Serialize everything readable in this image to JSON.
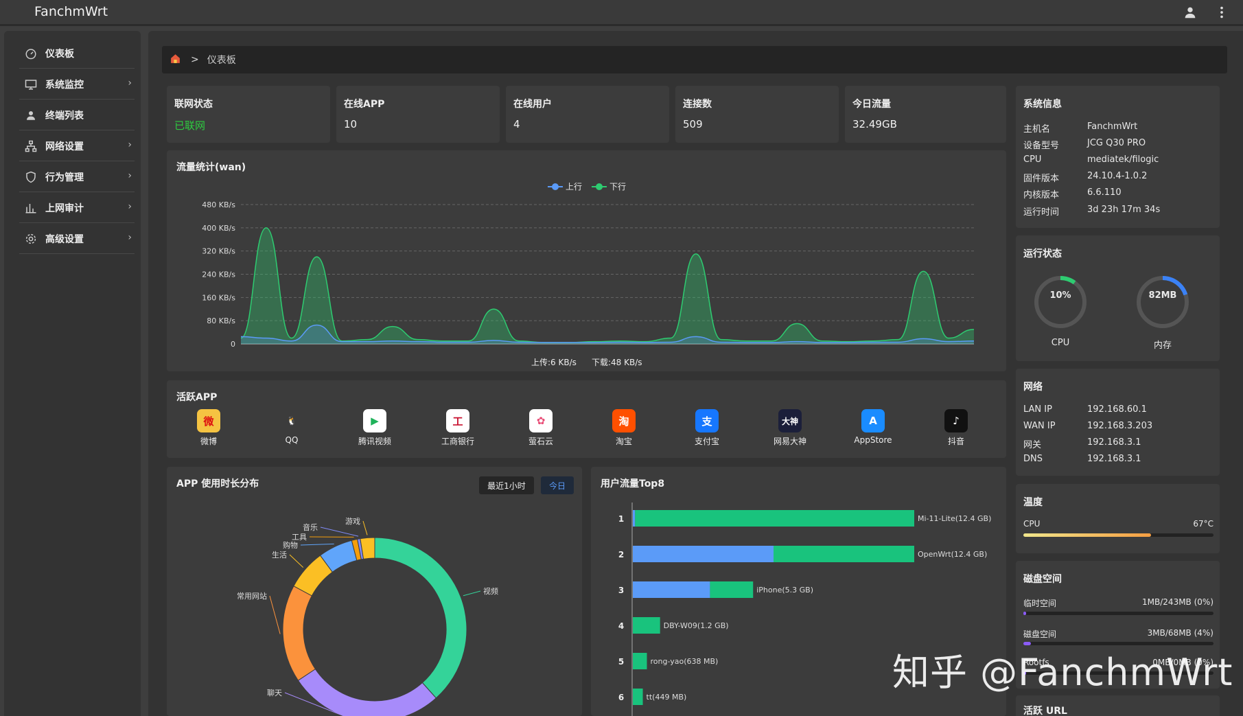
{
  "app": {
    "title": "FanchmWrt"
  },
  "topbar": {
    "user_icon": "user-icon",
    "menu_icon": "more-vertical-icon"
  },
  "sidebar": {
    "items": [
      {
        "label": "仪表板",
        "icon": "dashboard-icon",
        "has_submenu": false
      },
      {
        "label": "系统监控",
        "icon": "monitor-icon",
        "has_submenu": true
      },
      {
        "label": "终端列表",
        "icon": "user-icon",
        "has_submenu": false
      },
      {
        "label": "网络设置",
        "icon": "network-icon",
        "has_submenu": true
      },
      {
        "label": "行为管理",
        "icon": "shield-icon",
        "has_submenu": true
      },
      {
        "label": "上网审计",
        "icon": "bar-chart-icon",
        "has_submenu": true
      },
      {
        "label": "高级设置",
        "icon": "gear-icon",
        "has_submenu": true
      }
    ],
    "chevron": "›"
  },
  "breadcrumb": {
    "home_icon": "home-icon",
    "separator": ">",
    "current": "仪表板"
  },
  "stats": [
    {
      "label": "联网状态",
      "value": "已联网",
      "color": "#2ecc40"
    },
    {
      "label": "在线APP",
      "value": "10"
    },
    {
      "label": "在线用户",
      "value": "4"
    },
    {
      "label": "连接数",
      "value": "509"
    },
    {
      "label": "今日流量",
      "value": "32.49GB"
    }
  ],
  "traffic": {
    "title": "流量统计(wan)",
    "legend": [
      {
        "name": "上行",
        "color": "#5b9bf8"
      },
      {
        "name": "下行",
        "color": "#2ecc71"
      }
    ],
    "summary_up": "上传:6 KB/s",
    "summary_down": "下载:48 KB/s"
  },
  "chart_data": [
    {
      "type": "area",
      "title": "流量统计(wan)",
      "y_ticks": [
        "480 KB/s",
        "400 KB/s",
        "320 KB/s",
        "240 KB/s",
        "160 KB/s",
        "80 KB/s",
        "0"
      ],
      "ylim": [
        0,
        480
      ],
      "y_unit": "KB/s",
      "grid": true,
      "legend_position": "top-center",
      "x": [
        0,
        1,
        2,
        3,
        4,
        5,
        6,
        7,
        8,
        9,
        10,
        11,
        12,
        13,
        14,
        15,
        16,
        17,
        18,
        19,
        20,
        21,
        22,
        23,
        24,
        25,
        26,
        27,
        28,
        29
      ],
      "series": [
        {
          "name": "下行",
          "color": "#2ecc71",
          "values": [
            20,
            400,
            20,
            300,
            10,
            15,
            60,
            15,
            10,
            10,
            120,
            10,
            5,
            5,
            8,
            10,
            8,
            20,
            310,
            15,
            10,
            10,
            70,
            10,
            8,
            10,
            15,
            250,
            20,
            50
          ]
        },
        {
          "name": "上行",
          "color": "#5b9bf8",
          "values": [
            25,
            20,
            10,
            65,
            8,
            8,
            10,
            8,
            6,
            6,
            12,
            6,
            5,
            5,
            5,
            6,
            5,
            6,
            25,
            6,
            5,
            5,
            8,
            5,
            5,
            6,
            6,
            18,
            8,
            10
          ]
        }
      ]
    },
    {
      "type": "pie",
      "title": "APP 使用时长分布",
      "labels": [
        "视频",
        "聊天",
        "常用网站",
        "生活",
        "购物",
        "工具",
        "音乐",
        "游戏"
      ],
      "values": [
        38,
        27,
        17,
        7,
        6,
        1,
        0.5,
        2.5
      ],
      "colors": [
        "#34d399",
        "#a78bfa",
        "#fb923c",
        "#fbbf24",
        "#60a5fa",
        "#f59e0b",
        "#818cf8",
        "#fbbf24"
      ],
      "visible_note": "chart truncated at bottom of view"
    },
    {
      "type": "bar",
      "title": "用户流量Top8",
      "categories": [
        "1",
        "2",
        "3",
        "4",
        "5",
        "6"
      ],
      "unit": "GB",
      "series": [
        {
          "name": "upload",
          "color": "#5b9bf8",
          "values": [
            0.1,
            6.2,
            3.4,
            0,
            0,
            0
          ]
        },
        {
          "name": "download",
          "color": "#19c37d",
          "values": [
            12.3,
            6.2,
            1.9,
            1.2,
            0.62,
            0.44
          ]
        }
      ],
      "bar_labels": [
        "Mi-11-Lite(12.4 GB)",
        "OpenWrt(12.4 GB)",
        "iPhone(5.3 GB)",
        "DBY-W09(1.2 GB)",
        "rong-yao(638 MB)",
        "tt(449 MB)"
      ]
    }
  ],
  "apps": {
    "title": "活跃APP",
    "items": [
      {
        "name": "微博",
        "icon": "weibo-icon",
        "bg": "#f5c342",
        "glyph": "微",
        "fg": "#d11"
      },
      {
        "name": "QQ",
        "icon": "qq-icon",
        "bg": "#3c3c3c",
        "glyph": "🐧",
        "fg": "#fff"
      },
      {
        "name": "腾讯视频",
        "icon": "tencent-video-icon",
        "bg": "#ffffff",
        "glyph": "▶",
        "fg": "#1fb25a"
      },
      {
        "name": "工商银行",
        "icon": "icbc-icon",
        "bg": "#ffffff",
        "glyph": "工",
        "fg": "#c8102e"
      },
      {
        "name": "萤石云",
        "icon": "ezviz-icon",
        "bg": "#ffffff",
        "glyph": "✿",
        "fg": "#e94e77"
      },
      {
        "name": "淘宝",
        "icon": "taobao-icon",
        "bg": "#ff5000",
        "glyph": "淘",
        "fg": "#fff"
      },
      {
        "name": "支付宝",
        "icon": "alipay-icon",
        "bg": "#1677ff",
        "glyph": "支",
        "fg": "#fff"
      },
      {
        "name": "网易大神",
        "icon": "netease-dashen-icon",
        "bg": "#1b1f3a",
        "glyph": "大神",
        "fg": "#fff"
      },
      {
        "name": "AppStore",
        "icon": "appstore-icon",
        "bg": "#1a8cff",
        "glyph": "A",
        "fg": "#fff"
      },
      {
        "name": "抖音",
        "icon": "douyin-icon",
        "bg": "#111",
        "glyph": "♪",
        "fg": "#fff"
      }
    ]
  },
  "app_usage": {
    "title": "APP 使用时长分布",
    "btn_hour": "最近1小时",
    "btn_today": "今日"
  },
  "top_users": {
    "title": "用户流量Top8"
  },
  "system": {
    "title": "系统信息",
    "rows": [
      {
        "k": "主机名",
        "v": "FanchmWrt"
      },
      {
        "k": "设备型号",
        "v": "JCG Q30 PRO"
      },
      {
        "k": "CPU",
        "v": "mediatek/filogic"
      },
      {
        "k": "固件版本",
        "v": "24.10.4-1.0.2"
      },
      {
        "k": "内核版本",
        "v": "6.6.110"
      },
      {
        "k": "运行时间",
        "v": "3d 23h 17m 34s"
      }
    ]
  },
  "runtime": {
    "title": "运行状态",
    "cpu": {
      "value": "10%",
      "label": "CPU",
      "percent": 10,
      "color": "#2ecc71"
    },
    "mem": {
      "value": "82MB",
      "label": "内存",
      "percent": 20,
      "color": "#3b82f6"
    }
  },
  "network": {
    "title": "网络",
    "rows": [
      {
        "k": "LAN IP",
        "v": "192.168.60.1"
      },
      {
        "k": "WAN IP",
        "v": "192.168.3.203"
      },
      {
        "k": "网关",
        "v": "192.168.3.1"
      },
      {
        "k": "DNS",
        "v": "192.168.3.1"
      }
    ]
  },
  "temperature": {
    "title": "温度",
    "label": "CPU",
    "value": "67°C",
    "percent": 67
  },
  "disk": {
    "title": "磁盘空间",
    "rows": [
      {
        "k": "临时空间",
        "v": "1MB/243MB (0%)",
        "percent": 0
      },
      {
        "k": "磁盘空间",
        "v": "3MB/68MB (4%)",
        "percent": 4
      },
      {
        "k": "Rootfs",
        "v": "0MB/0MB (0%)",
        "percent": 0
      }
    ]
  },
  "active_url": {
    "title": "活跃 URL"
  },
  "watermark": "知乎 @FanchmWrt"
}
